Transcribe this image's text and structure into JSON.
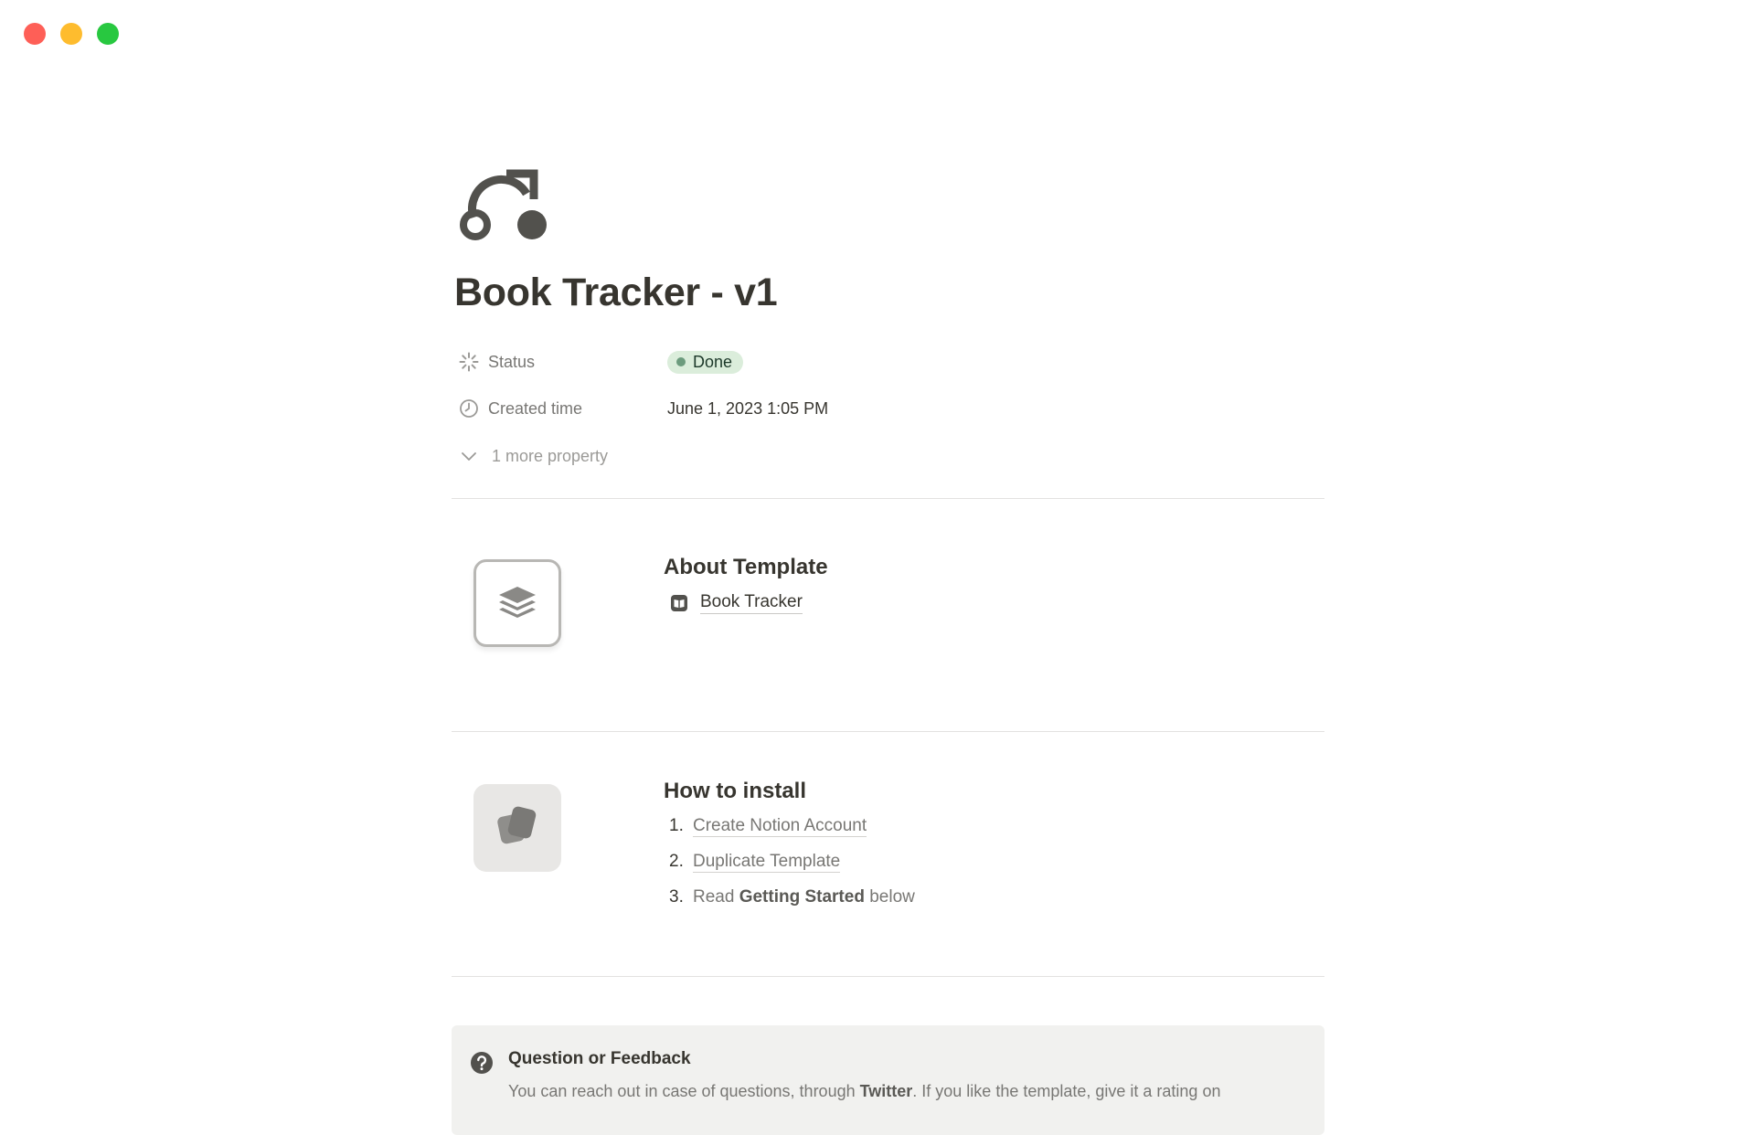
{
  "window": {
    "controls": [
      "close",
      "minimize",
      "maximize"
    ],
    "colors": {
      "close": "#fe5f57",
      "minimize": "#febc2e",
      "maximize": "#28c840"
    }
  },
  "page": {
    "icon": "arrow-redo-dots-icon",
    "title": "Book Tracker - v1"
  },
  "properties": {
    "status": {
      "label": "Status",
      "value": "Done",
      "icon": "status-spinner-icon",
      "badge_color": "#dbeddb"
    },
    "created_time": {
      "label": "Created time",
      "value": "June 1, 2023 1:05 PM",
      "icon": "clock-icon"
    },
    "more": {
      "label": "1 more property",
      "icon": "chevron-down-icon"
    }
  },
  "about": {
    "heading": "About Template",
    "tile_icon": "layers-icon",
    "link_icon": "book-icon",
    "link_label": "Book Tracker"
  },
  "install": {
    "heading": "How to install",
    "tile_icon": "cards-icon",
    "steps": [
      {
        "number": "1.",
        "text": "Create Notion Account"
      },
      {
        "number": "2.",
        "text": "Duplicate Template"
      },
      {
        "number": "3.",
        "prefix": "Read ",
        "bold": "Getting Started",
        "suffix": " below"
      }
    ]
  },
  "callout": {
    "icon": "question-circle-icon",
    "title": "Question or Feedback",
    "body_prefix": "You can reach out in case of questions, through ",
    "body_bold": "Twitter",
    "body_suffix": ". If you like the template, give it a rating on"
  }
}
